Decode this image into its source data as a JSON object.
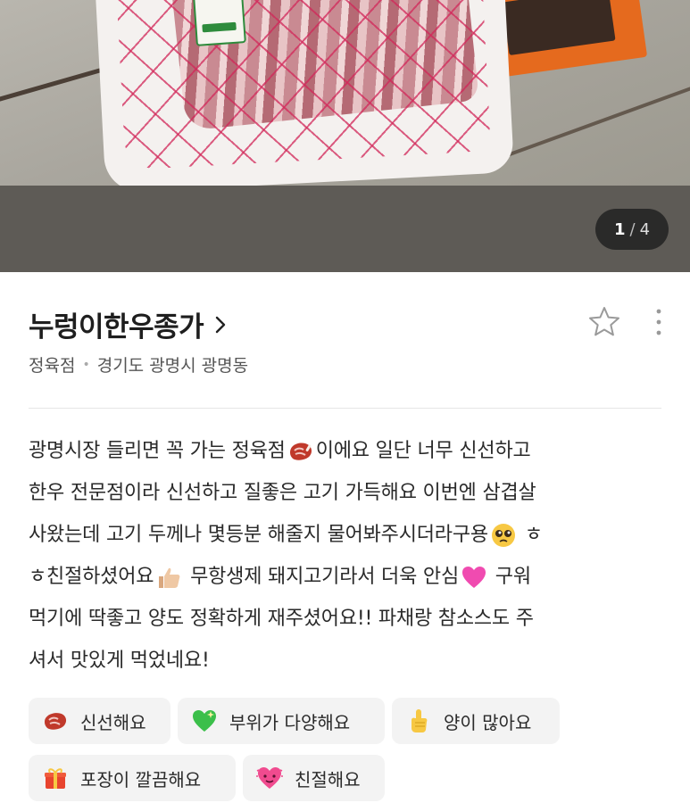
{
  "gallery": {
    "current": "1",
    "separator": "/",
    "total": "4"
  },
  "place": {
    "name": "누렁이한우종가",
    "category": "정육점",
    "location": "경기도 광명시 광명동"
  },
  "review": {
    "lines": [
      [
        "광명시장 들리면 꼭 가는 정육점",
        "meat-icon",
        "이에요 일단 너무 신선하고"
      ],
      [
        "한우 전문점이라 신선하고 질좋은 고기 가득해요 이번엔 삼겹살"
      ],
      [
        "사왔는데 고기 두께나 몇등분 해줄지 물어봐주시더라구용",
        "pleading-face-icon",
        " ㅎ"
      ],
      [
        "ㅎ친절하셨어요",
        "thumbs-up-icon",
        " 무항생제 돼지고기라서 더욱 안심",
        "pink-heart-icon",
        " 구워"
      ],
      [
        "먹기에 딱좋고 양도 정확하게 재주셨어요!! 파채랑 참소스도 주"
      ],
      [
        "셔서 맛있게 먹었네요!"
      ]
    ]
  },
  "tags": [
    {
      "icon": "meat-icon",
      "label": "신선해요"
    },
    {
      "icon": "green-heart-icon",
      "label": "부위가 다양해요"
    },
    {
      "icon": "pointing-up-icon",
      "label": "양이 많아요"
    },
    {
      "icon": "gift-icon",
      "label": "포장이 깔끔해요"
    },
    {
      "icon": "beating-heart-icon",
      "label": "친절해요"
    }
  ],
  "colors": {
    "counter_bg": "#1c1c1c",
    "tag_bg": "#f3f3f3",
    "title": "#1e1e1e"
  }
}
